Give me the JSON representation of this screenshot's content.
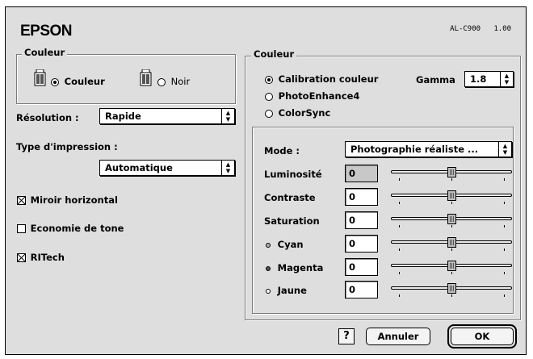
{
  "header": {
    "brand": "EPSON",
    "model": "AL-C900",
    "version": "1.00"
  },
  "left": {
    "couleur_group": {
      "title": "Couleur",
      "option_color": "Couleur",
      "option_mono": "Noir",
      "selected": "Couleur"
    },
    "resolution": {
      "label": "Résolution :",
      "value": "Rapide"
    },
    "print_type": {
      "label": "Type d'impression :",
      "value": "Automatique"
    },
    "checks": [
      {
        "label": "Miroir horizontal",
        "checked": true
      },
      {
        "label": "Economie de tone",
        "checked": false
      },
      {
        "label": "RITech",
        "checked": true
      }
    ]
  },
  "right": {
    "title": "Couleur",
    "modes": [
      {
        "label": "Calibration couleur",
        "selected": true
      },
      {
        "label": "PhotoEnhance4",
        "selected": false
      },
      {
        "label": "ColorSync",
        "selected": false
      }
    ],
    "gamma": {
      "label": "Gamma",
      "value": "1.8"
    },
    "mode": {
      "label": "Mode :",
      "value": "Photographie réaliste ..."
    },
    "adjustments": [
      {
        "label": "Luminosité",
        "value": "0",
        "disabled": true,
        "dot": ""
      },
      {
        "label": "Contraste",
        "value": "0",
        "disabled": false,
        "dot": ""
      },
      {
        "label": "Saturation",
        "value": "0",
        "disabled": false,
        "dot": ""
      },
      {
        "label": "Cyan",
        "value": "0",
        "disabled": false,
        "dot": "cyan"
      },
      {
        "label": "Magenta",
        "value": "0",
        "disabled": false,
        "dot": "magenta"
      },
      {
        "label": "Jaune",
        "value": "0",
        "disabled": false,
        "dot": "yellow"
      }
    ]
  },
  "footer": {
    "help": "?",
    "cancel": "Annuler",
    "ok": "OK"
  }
}
